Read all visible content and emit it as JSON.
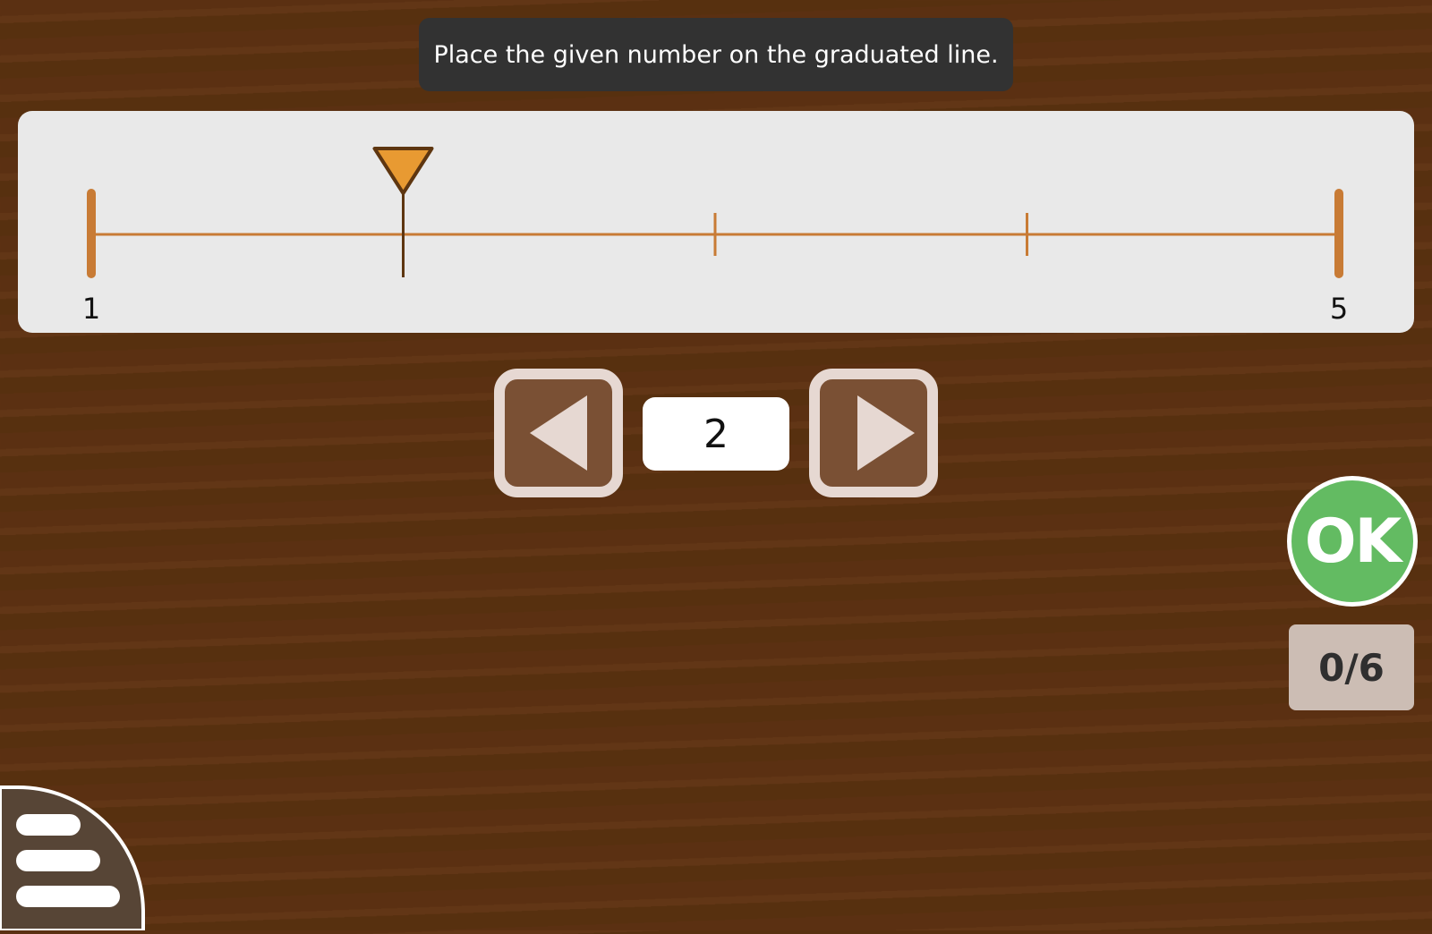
{
  "instruction": "Place the given number on the graduated line.",
  "number_line": {
    "min_label": "1",
    "max_label": "5",
    "min": 1,
    "max": 5,
    "divisions": 4,
    "marker_value": 2
  },
  "stepper": {
    "value": "2",
    "prev_icon": "triangle-left-icon",
    "next_icon": "triangle-right-icon"
  },
  "ok_label": "OK",
  "score": "0/6",
  "menu_icon": "hamburger-menu-icon",
  "colors": {
    "line": "#c87b35",
    "marker_fill": "#e89a32",
    "marker_stroke": "#5e3610",
    "ok_green": "#63bb62"
  }
}
